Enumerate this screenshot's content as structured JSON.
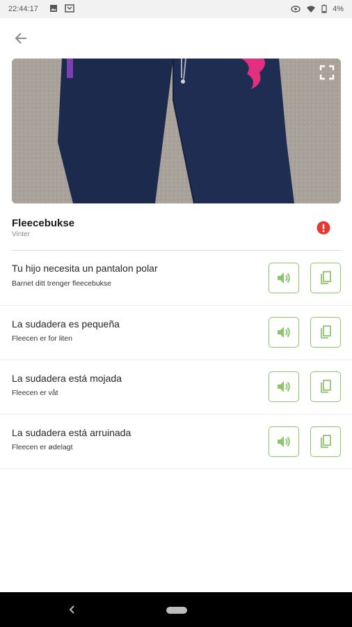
{
  "status_bar": {
    "time": "22:44:17",
    "battery": "4%"
  },
  "item": {
    "title": "Fleecebukse",
    "category": "Vinter"
  },
  "phrases": [
    {
      "text": "Tu hijo necesita un pantalon polar",
      "translation": "Barnet ditt trenger fleecebukse"
    },
    {
      "text": "La sudadera es pequeña",
      "translation": "Fleecen er for liten"
    },
    {
      "text": "La sudadera está mojada",
      "translation": "Fleecen er våt"
    },
    {
      "text": "La sudadera está arruinada",
      "translation": "Fleecen er ødelagt"
    }
  ],
  "colors": {
    "accent": "#8cc66a",
    "alert": "#e53935",
    "nav_bar": "#000000"
  },
  "icons": {
    "back": "arrow-left-icon",
    "expand": "fullscreen-icon",
    "alert": "exclamation-icon",
    "speak": "speaker-icon",
    "copy": "copy-icon"
  }
}
